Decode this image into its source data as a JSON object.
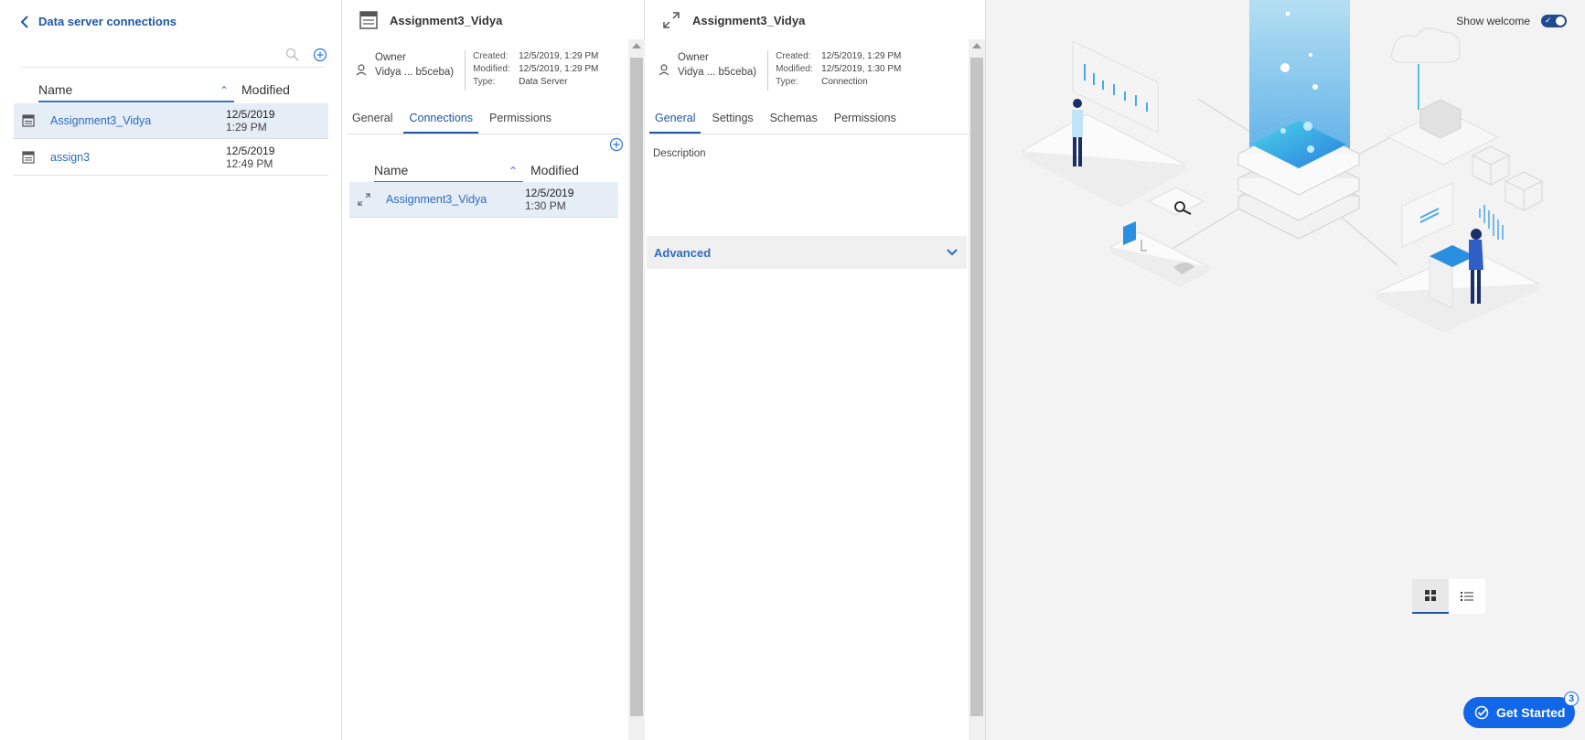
{
  "left_panel": {
    "back_label": "Data server connections",
    "columns": {
      "name": "Name",
      "modified": "Modified"
    },
    "rows": [
      {
        "name": "Assignment3_Vidya",
        "date": "12/5/2019",
        "time": "1:29 PM"
      },
      {
        "name": "assign3",
        "date": "12/5/2019",
        "time": "12:49 PM"
      }
    ]
  },
  "server_panel": {
    "title": "Assignment3_Vidya",
    "owner_label": "Owner",
    "owner_value": "Vidya ... b5ceba)",
    "created_label": "Created:",
    "created_value": "12/5/2019, 1:29 PM",
    "modified_label": "Modified:",
    "modified_value": "12/5/2019, 1:29 PM",
    "type_label": "Type:",
    "type_value": "Data Server",
    "tabs": [
      "General",
      "Connections",
      "Permissions"
    ],
    "active_tab": "Connections",
    "columns": {
      "name": "Name",
      "modified": "Modified"
    },
    "rows": [
      {
        "name": "Assignment3_Vidya",
        "date": "12/5/2019",
        "time": "1:30 PM"
      }
    ]
  },
  "connection_panel": {
    "title": "Assignment3_Vidya",
    "owner_label": "Owner",
    "owner_value": "Vidya ... b5ceba)",
    "created_label": "Created:",
    "created_value": "12/5/2019, 1:29 PM",
    "modified_label": "Modified:",
    "modified_value": "12/5/2019, 1:30 PM",
    "type_label": "Type:",
    "type_value": "Connection",
    "tabs": [
      "General",
      "Settings",
      "Schemas",
      "Permissions"
    ],
    "active_tab": "General",
    "description_label": "Description",
    "advanced_label": "Advanced"
  },
  "right_panel": {
    "show_welcome_label": "Show welcome",
    "get_started_label": "Get Started",
    "get_started_badge": "3"
  },
  "colors": {
    "accent": "#1f57a4",
    "link": "#2d6cc0",
    "selected_row": "#e5edf7",
    "cta": "#1167e8"
  }
}
